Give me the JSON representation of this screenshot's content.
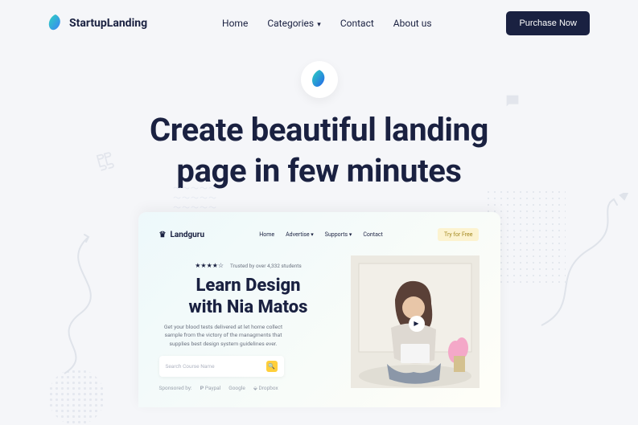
{
  "nav": {
    "brand": "StartupLanding",
    "links": {
      "home": "Home",
      "categories": "Categories",
      "contact": "Contact",
      "about": "About us"
    },
    "purchase": "Purchase Now"
  },
  "hero": {
    "title_l1": "Create beautiful landing",
    "title_l2": "page in few minutes"
  },
  "preview": {
    "brand": "Landguru",
    "nav": {
      "home": "Home",
      "advertise": "Advertise ▾",
      "supports": "Supports ▾",
      "contact": "Contact"
    },
    "cta": "Try for Free",
    "stars": "★★★★☆",
    "trust": "Trusted by over 4,332 students",
    "heading_l1": "Learn Design",
    "heading_l2": "with Nia Matos",
    "sub": "Get your blood tests delivered at let home collect sample from the victory of the managments that supplies best design system guidelines ever.",
    "search_placeholder": "Search Course Name",
    "sponsored": "Sponsored by:",
    "sponsors": {
      "paypal": "Paypal",
      "google": "Google",
      "dropbox": "Dropbox"
    }
  }
}
